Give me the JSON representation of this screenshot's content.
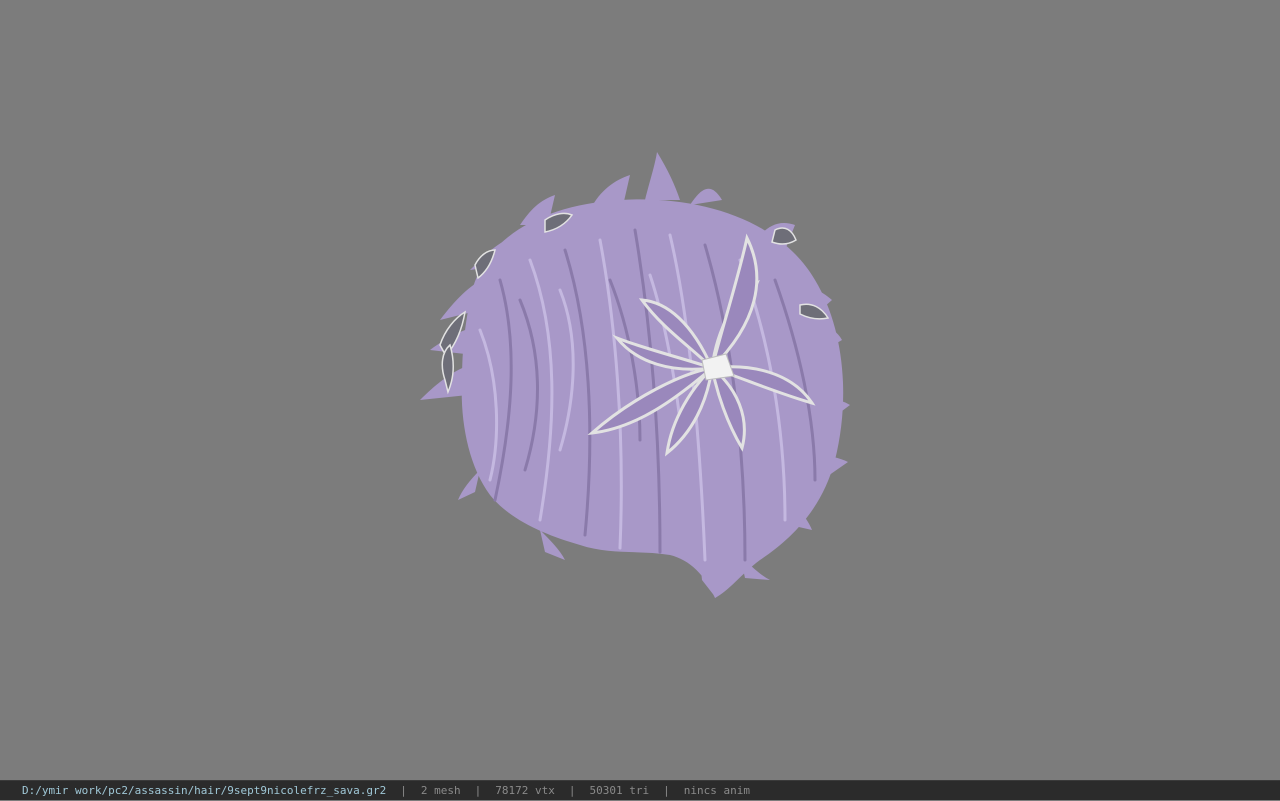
{
  "viewer": {
    "background_color": "#7c7c7c",
    "model": {
      "hair_color": "#a898c8",
      "hair_shadow": "#8a7aaa",
      "hair_highlight": "#c4b8e0",
      "flower_petal_color": "#9a88bc",
      "flower_edge_color": "#e2e2e2"
    }
  },
  "statusbar": {
    "file_path": "D:/ymir work/pc2/assassin/hair/9sept9nicolefrz_sava.gr2",
    "separator": "|",
    "mesh_count": "2 mesh",
    "vertex_count": "78172 vtx",
    "triangle_count": "50301 tri",
    "anim_status": "nincs anim",
    "path_color": "#9fc7d6",
    "stat_color": "#8a8a8a"
  }
}
